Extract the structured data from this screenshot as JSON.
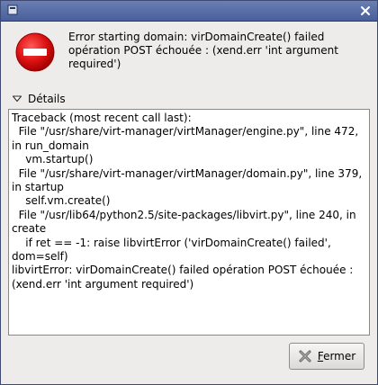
{
  "window": {
    "title": ""
  },
  "message": {
    "text": "Error starting domain: virDomainCreate() failed\nopération POST échouée : (xend.err 'int argument\nrequired')"
  },
  "details": {
    "label": "Détails",
    "expanded": true,
    "traceback": "Traceback (most recent call last):\n  File \"/usr/share/virt-manager/virtManager/engine.py\", line 472, in run_domain\n    vm.startup()\n  File \"/usr/share/virt-manager/virtManager/domain.py\", line 379, in startup\n    self.vm.create()\n  File \"/usr/lib64/python2.5/site-packages/libvirt.py\", line 240, in create\n    if ret == -1: raise libvirtError ('virDomainCreate() failed', dom=self)\nlibvirtError: virDomainCreate() failed opération POST échouée : (xend.err 'int argument required')"
  },
  "buttons": {
    "close_mnemonic": "F",
    "close_rest": "ermer"
  },
  "icons": {
    "app": "app-icon",
    "window_close": "close-icon",
    "error": "error-icon",
    "expander": "expander-arrow-icon",
    "close_button": "close-x-icon"
  },
  "colors": {
    "titlebar": "#5a6ea8",
    "error_red": "#cc0000",
    "background": "#edeceb"
  }
}
